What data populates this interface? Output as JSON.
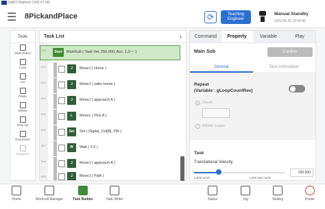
{
  "window_title": "DART-Platform (V02.07.00)",
  "header": {
    "app_title": "8PickandPlace",
    "teach_button": "Teaching Engineer",
    "status": "Manual Standby",
    "date": "2022.06.25 19:05:46"
  },
  "tools": {
    "title": "Tools",
    "items": [
      {
        "label": "Multi-Select",
        "enabled": true
      },
      {
        "label": "Copy",
        "enabled": true
      },
      {
        "label": "Cut",
        "enabled": true
      },
      {
        "label": "Paste",
        "enabled": true
      },
      {
        "label": "Delete",
        "enabled": true
      },
      {
        "label": "Row Up",
        "enabled": true
      },
      {
        "label": "Row Down",
        "enabled": true
      },
      {
        "label": "Suppress",
        "enabled": false
      }
    ]
  },
  "tasklist": {
    "title": "Task List",
    "rows": [
      {
        "line": "001",
        "icon": "Start",
        "text": "MainSub  ( Task Vel. 250.000, Acc. 1,0~~ )",
        "selected": true
      },
      {
        "line": "002",
        "icon": "J",
        "text": "MoveJ  ( Home )"
      },
      {
        "line": "003",
        "icon": "J",
        "text": "MoveJ  ( safer home )"
      },
      {
        "line": "004",
        "icon": "J",
        "text": "MoveJ  ( approach A )"
      },
      {
        "line": "005",
        "icon": "L",
        "text": "MoveL  ( Pick A )"
      },
      {
        "line": "006",
        "icon": "Set",
        "text": "Set  ( Digital_Out[5], ON )"
      },
      {
        "line": "007",
        "icon": "W",
        "text": "Wait  ( 2.0 )"
      },
      {
        "line": "008",
        "icon": "J",
        "text": "MoveJ  ( approach A )"
      },
      {
        "line": "009",
        "icon": "J",
        "text": "MoveJ  ( Path )"
      }
    ]
  },
  "panel": {
    "tabs": [
      "Command",
      "Property",
      "Variable",
      "Play"
    ],
    "active_tab": 1,
    "section_title": "Main Sub",
    "confirm": "Confirm",
    "subtabs": [
      "General",
      "Task Information"
    ],
    "repeat_label": "Repeat",
    "repeat_var": "(Variable : gLoopCountRev)",
    "repeat_on": false,
    "count_label": "Count",
    "infinite_label": "Infinite Loops",
    "task_label": "Task",
    "velocity_label": "Translational Velocity",
    "velocity_min": "0,000 mm/s",
    "velocity_max": "1,000,000 mm/s",
    "velocity_value": "250.000"
  },
  "nav": {
    "items": [
      {
        "label": "Home",
        "active": false
      },
      {
        "label": "Workcell Manager",
        "active": false
      },
      {
        "label": "Task Builder",
        "active": true
      },
      {
        "label": "Task Writer",
        "active": false
      },
      {
        "label": "Status",
        "active": false
      },
      {
        "label": "Jog",
        "active": false
      },
      {
        "label": "Setting",
        "active": false
      },
      {
        "label": "Power",
        "active": false
      }
    ]
  }
}
